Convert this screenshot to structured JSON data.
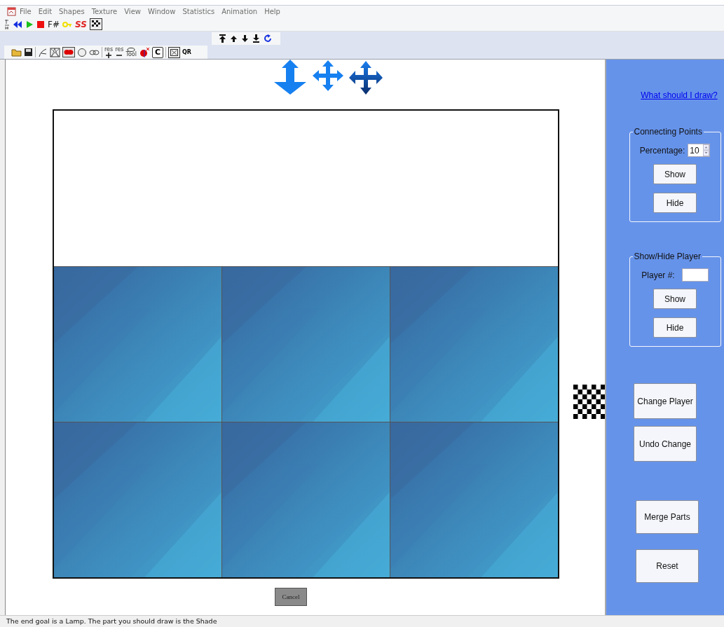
{
  "menu": [
    "File",
    "Edit",
    "Shapes",
    "Texture",
    "View",
    "Window",
    "Statistics",
    "Animation",
    "Help"
  ],
  "play_toolbar": {
    "labels": [
      "F#",
      "SS"
    ]
  },
  "shape_toolbar": {
    "labels": [
      "res",
      "res",
      "Tool",
      "C",
      "QR"
    ]
  },
  "canvas": {
    "cancel_button": "Cancel"
  },
  "panel": {
    "help_link": "What should I draw?",
    "connecting_points": {
      "title": "Connecting Points",
      "percentage_label": "Percentage:",
      "percentage_value": "10",
      "buttons": [
        "Show",
        "Hide"
      ]
    },
    "show_hide_player": {
      "title": "Show/Hide Player",
      "player_label": "Player #:",
      "buttons": [
        "Show",
        "Hide"
      ]
    },
    "actions": [
      {
        "label": "Change Player",
        "kind": "top"
      },
      {
        "label": "Undo Change",
        "kind": "top"
      },
      {
        "label": "Merge Parts",
        "kind": "bottom"
      },
      {
        "label": "Reset",
        "kind": "bottom"
      }
    ]
  },
  "status_bar": "The end goal is a Lamp. The part you should draw is the Shade"
}
